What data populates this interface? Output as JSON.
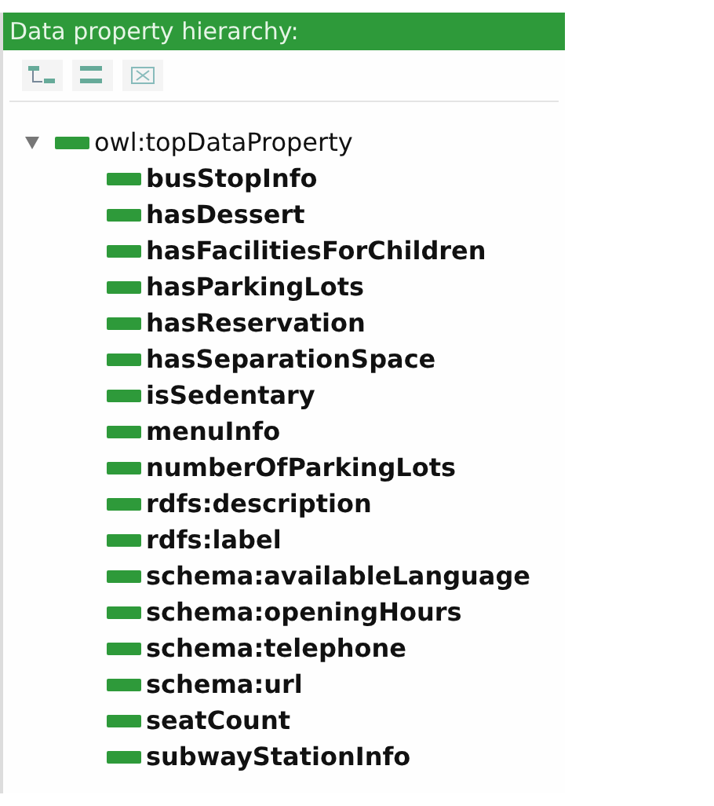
{
  "panel": {
    "title": "Data property hierarchy:"
  },
  "tree": [
    {
      "label": "owl:topDataProperty",
      "expanded": true,
      "children": [
        {
          "label": "busStopInfo"
        },
        {
          "label": "hasDessert"
        },
        {
          "label": "hasFacilitiesForChildren"
        },
        {
          "label": "hasParkingLots"
        },
        {
          "label": "hasReservation"
        },
        {
          "label": "hasSeparationSpace"
        },
        {
          "label": "isSedentary"
        },
        {
          "label": "menuInfo"
        },
        {
          "label": "numberOfParkingLots"
        },
        {
          "label": "rdfs:description"
        },
        {
          "label": "rdfs:label"
        },
        {
          "label": "schema:availableLanguage"
        },
        {
          "label": "schema:openingHours"
        },
        {
          "label": "schema:telephone"
        },
        {
          "label": "schema:url"
        },
        {
          "label": "seatCount"
        },
        {
          "label": "subwayStationInfo"
        }
      ]
    }
  ]
}
